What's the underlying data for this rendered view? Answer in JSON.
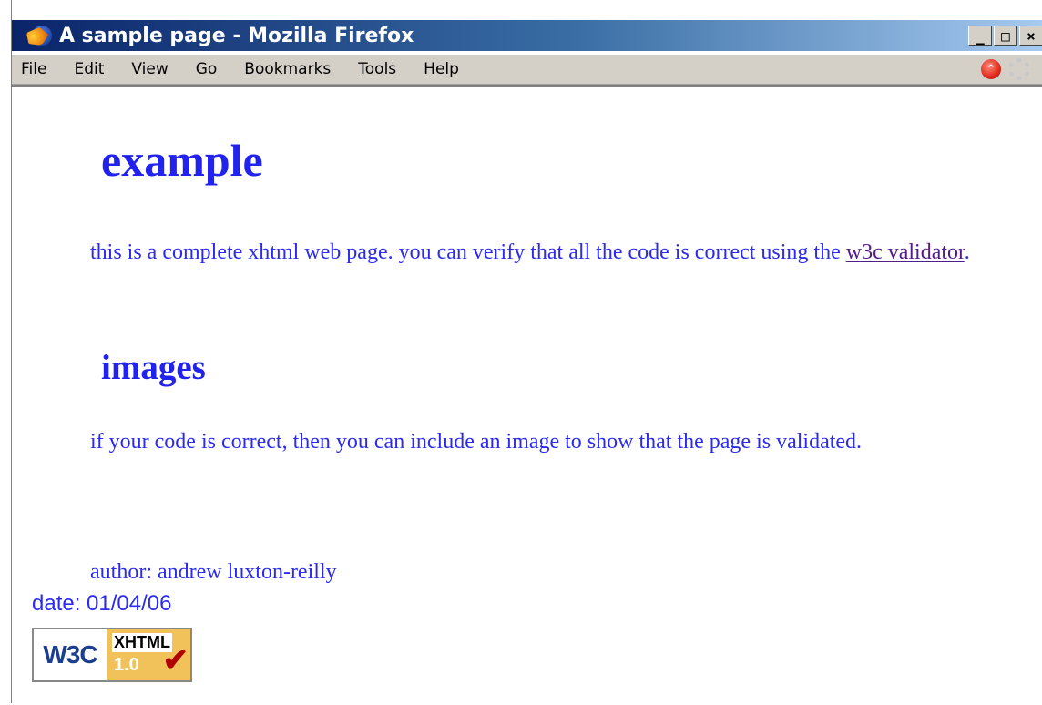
{
  "window": {
    "title": "A sample page - Mozilla Firefox",
    "buttons": [
      "_",
      "□",
      "×"
    ]
  },
  "menu": {
    "items": [
      {
        "label": "File"
      },
      {
        "label": "Edit"
      },
      {
        "label": "View"
      },
      {
        "label": "Go"
      },
      {
        "label": "Bookmarks"
      },
      {
        "label": "Tools"
      },
      {
        "label": "Help"
      }
    ]
  },
  "icons": {
    "app": "firefox-icon",
    "update": "update-available-icon",
    "throbber": "throbber-icon"
  },
  "page": {
    "heading": "example",
    "para1_text": "this is a complete xhtml web page. you can verify that all the code is correct using the",
    "para1_link": "w3c validator",
    "para1_end": ".",
    "subheading": "images",
    "para2": "if your code is correct, then you can include an image to show that the page is validated.",
    "author": "author: andrew luxton-reilly",
    "date": "date: 01/04/06",
    "badge": {
      "w3c": "W3C",
      "label": "XHTML",
      "version": "1.0"
    }
  },
  "colors": {
    "text": "#2b2bf0",
    "heading": "#2222ee",
    "link_visited": "#551a8b",
    "titlebar": "#0a246a",
    "chrome": "#d4d0c8"
  }
}
